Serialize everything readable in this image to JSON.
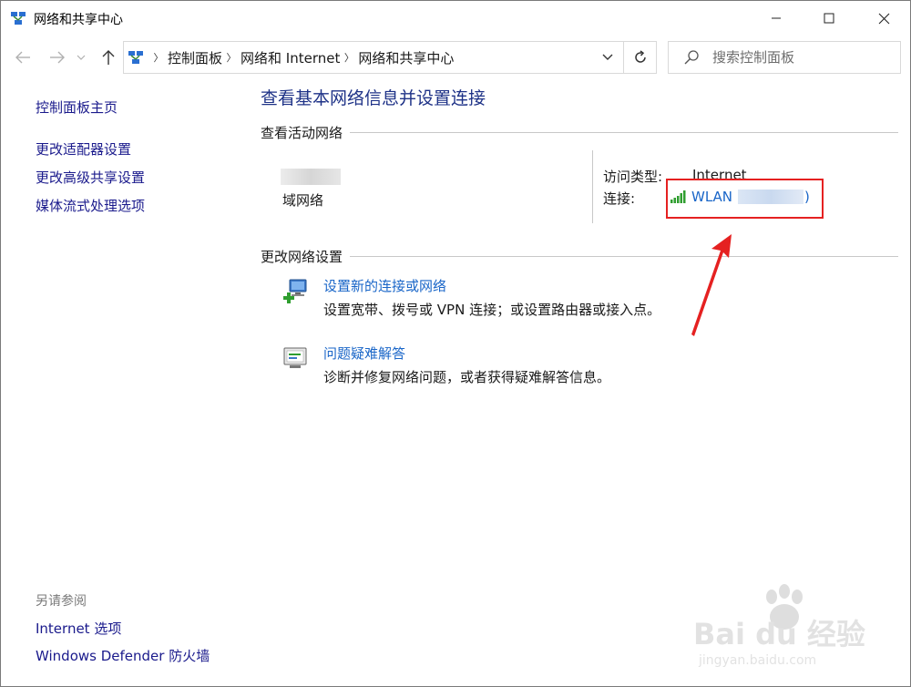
{
  "window": {
    "title": "网络和共享中心"
  },
  "nav": {
    "breadcrumbs": [
      "控制面板",
      "网络和 Internet",
      "网络和共享中心"
    ],
    "search_placeholder": "搜索控制面板"
  },
  "sidebar": {
    "links": [
      "控制面板主页",
      "更改适配器设置",
      "更改高级共享设置",
      "媒体流式处理选项"
    ],
    "see_also_label": "另请参阅",
    "see_also_links": [
      "Internet 选项",
      "Windows Defender 防火墙"
    ]
  },
  "main": {
    "title": "查看基本网络信息并设置连接",
    "active_networks_heading": "查看活动网络",
    "network_category": "域网络",
    "access_type_label": "访问类型:",
    "access_type_value": "Internet",
    "connection_label": "连接:",
    "connection_name": "WLAN",
    "connection_suffix": ")",
    "change_settings_heading": "更改网络设置",
    "tasks": [
      {
        "link": "设置新的连接或网络",
        "desc": "设置宽带、拨号或 VPN 连接；或设置路由器或接入点。"
      },
      {
        "link": "问题疑难解答",
        "desc": "诊断并修复网络问题，或者获得疑难解答信息。"
      }
    ]
  },
  "watermark": {
    "brand": "Bai du 经验",
    "url": "jingyan.baidu.com"
  },
  "colors": {
    "link": "#1a66c8",
    "title_blue": "#1e3287",
    "highlight_red": "#e52121"
  }
}
